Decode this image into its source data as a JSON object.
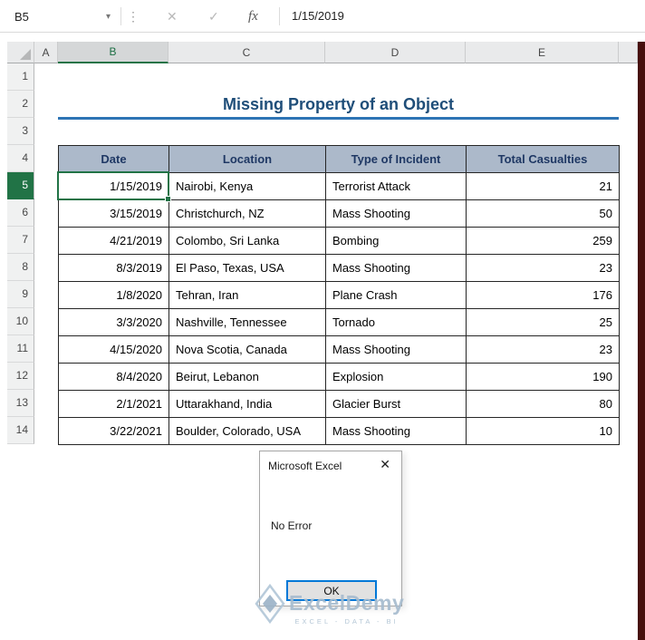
{
  "formula_bar": {
    "name_box": "B5",
    "content": "1/15/2019",
    "icons": {
      "dropdown": "▾",
      "handle": "⋮",
      "cancel": "✕",
      "enter": "✓",
      "fx": "fx"
    }
  },
  "sheet": {
    "columns": [
      "A",
      "B",
      "C",
      "D",
      "E"
    ],
    "row_numbers": [
      "1",
      "2",
      "3",
      "4",
      "5",
      "6",
      "7",
      "8",
      "9",
      "10",
      "11",
      "12",
      "13",
      "14"
    ],
    "title": "Missing Property of an Object"
  },
  "table": {
    "headers": [
      "Date",
      "Location",
      "Type of Incident",
      "Total Casualties"
    ],
    "rows": [
      {
        "date": "1/15/2019",
        "location": "Nairobi, Kenya",
        "incident": "Terrorist Attack",
        "casualties": "21"
      },
      {
        "date": "3/15/2019",
        "location": "Christchurch, NZ",
        "incident": "Mass Shooting",
        "casualties": "50"
      },
      {
        "date": "4/21/2019",
        "location": "Colombo, Sri Lanka",
        "incident": "Bombing",
        "casualties": "259"
      },
      {
        "date": "8/3/2019",
        "location": "El Paso, Texas, USA",
        "incident": "Mass Shooting",
        "casualties": "23"
      },
      {
        "date": "1/8/2020",
        "location": "Tehran, Iran",
        "incident": "Plane Crash",
        "casualties": "176"
      },
      {
        "date": "3/3/2020",
        "location": "Nashville, Tennessee",
        "incident": "Tornado",
        "casualties": "25"
      },
      {
        "date": "4/15/2020",
        "location": "Nova Scotia, Canada",
        "incident": "Mass Shooting",
        "casualties": "23"
      },
      {
        "date": "8/4/2020",
        "location": "Beirut, Lebanon",
        "incident": "Explosion",
        "casualties": "190"
      },
      {
        "date": "2/1/2021",
        "location": "Uttarakhand, India",
        "incident": "Glacier Burst",
        "casualties": "80"
      },
      {
        "date": "3/22/2021",
        "location": "Boulder, Colorado, USA",
        "incident": "Mass Shooting",
        "casualties": "10"
      }
    ]
  },
  "dialog": {
    "title": "Microsoft Excel",
    "close_icon": "✕",
    "message": "No Error",
    "ok_label": "OK"
  },
  "watermark": {
    "brand": "ExcelDemy",
    "tagline": "EXCEL - DATA - BI"
  },
  "colors": {
    "selection_green": "#217346",
    "table_header_bg": "#acb9ca",
    "table_header_text": "#1f3864",
    "title_text": "#1f4e79",
    "title_rule": "#2e74b5",
    "ok_button_border": "#0078d7",
    "edge_strip": "#470f0d"
  }
}
